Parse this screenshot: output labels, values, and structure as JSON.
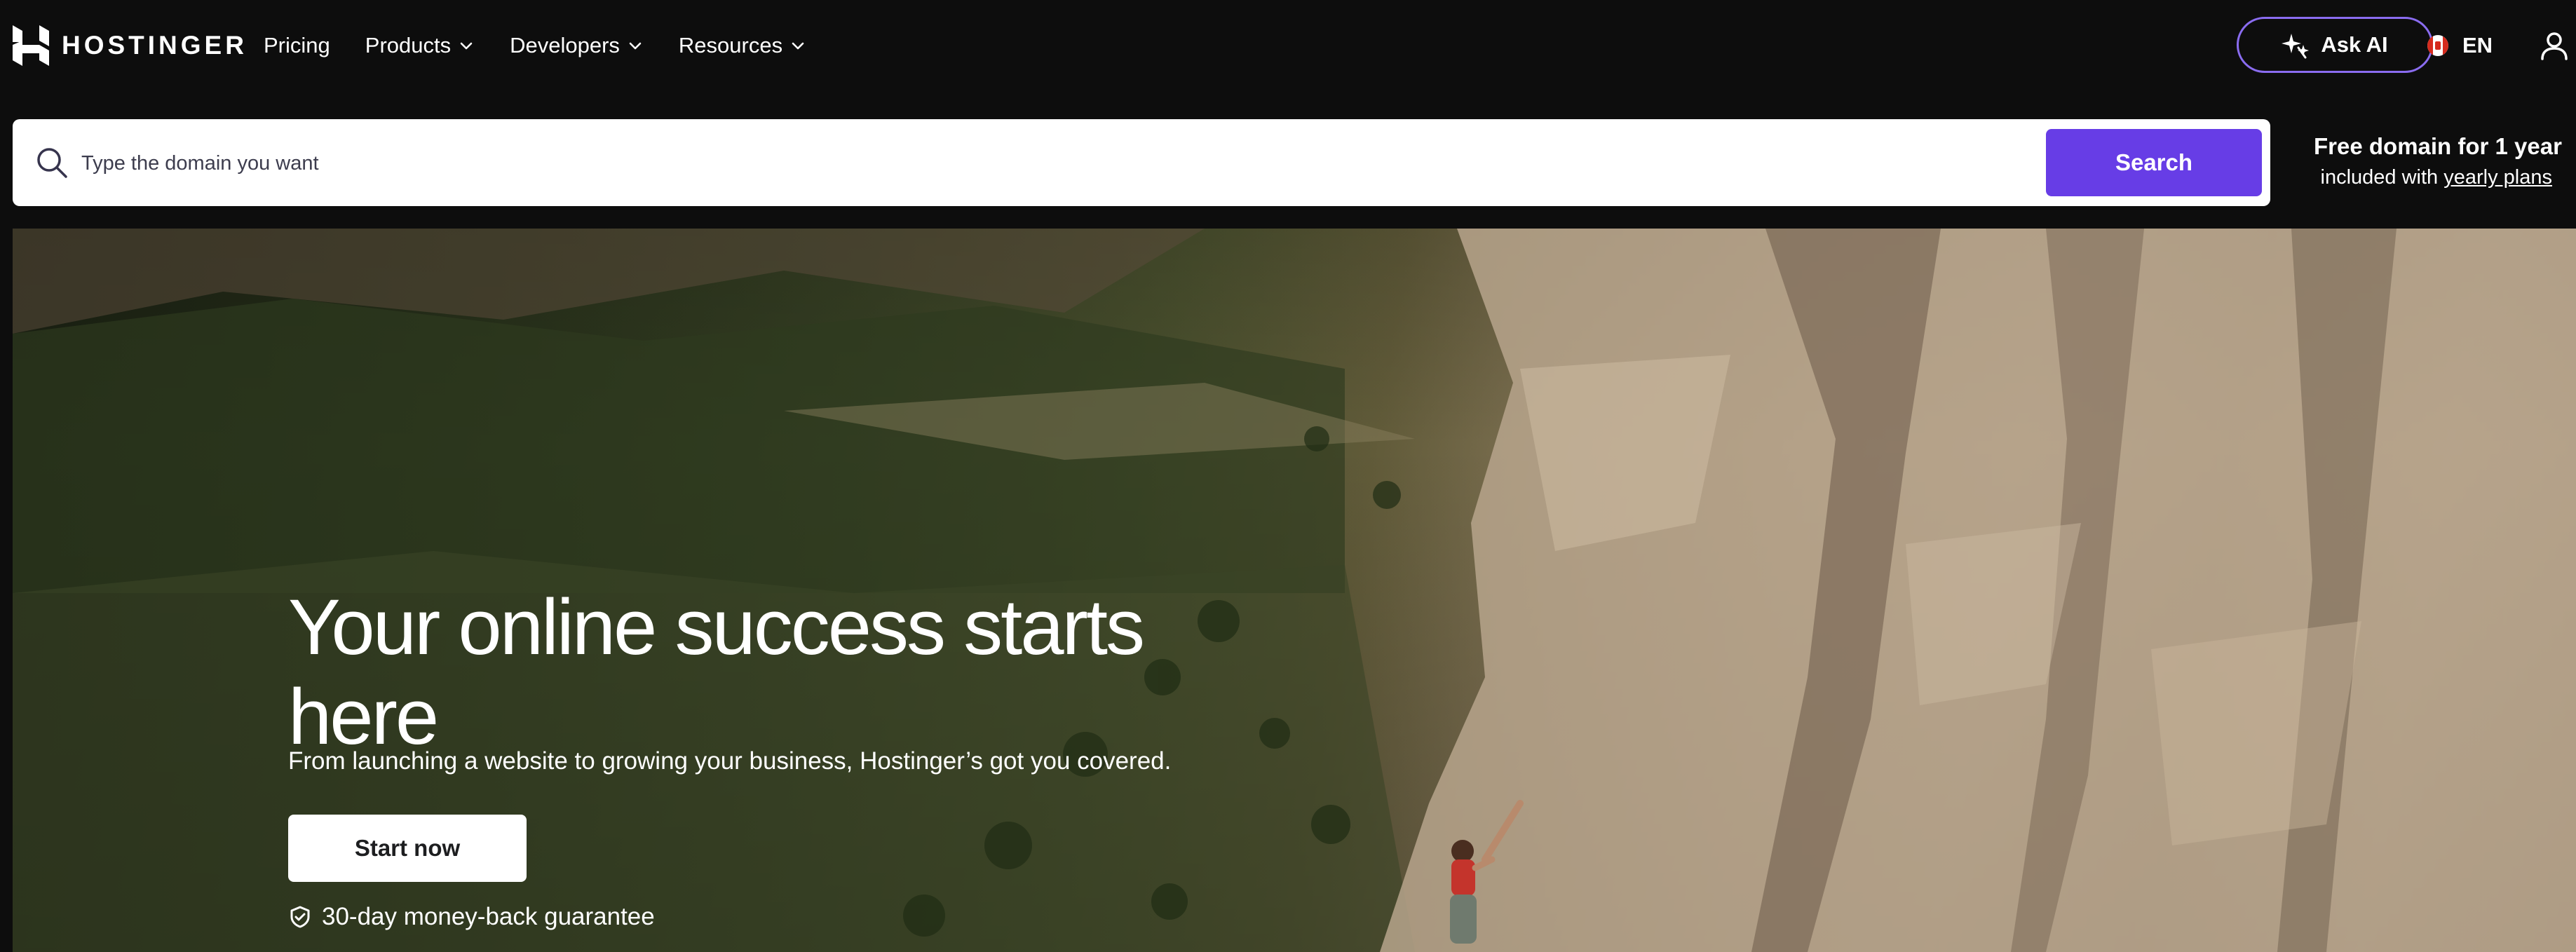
{
  "brand": {
    "name": "HOSTINGER"
  },
  "nav": {
    "items": [
      {
        "label": "Pricing",
        "has_dropdown": false
      },
      {
        "label": "Products",
        "has_dropdown": true
      },
      {
        "label": "Developers",
        "has_dropdown": true
      },
      {
        "label": "Resources",
        "has_dropdown": true
      }
    ],
    "ask_ai_label": "Ask AI",
    "language": "EN"
  },
  "search": {
    "placeholder": "Type the domain you want",
    "value": "",
    "button_label": "Search"
  },
  "promo": {
    "title": "Free domain for 1 year",
    "sub_prefix": "included with ",
    "sub_link": "yearly plans"
  },
  "hero": {
    "title": "Your online success starts here",
    "subtitle": "From launching a website to growing your business, Hostinger’s got you covered.",
    "cta_label": "Start now",
    "guarantee": "30-day money-back guarantee"
  },
  "colors": {
    "background": "#0d0d0d",
    "accent": "#673de6",
    "ask_ai_border": "#8a6cf0"
  },
  "icons": {
    "logo": "hostinger-logo-icon",
    "chevron": "chevron-down-icon",
    "ask_ai": "sparkle-icon",
    "flag": "canada-flag-icon",
    "user": "user-icon",
    "search": "search-icon",
    "shield": "shield-check-icon"
  }
}
